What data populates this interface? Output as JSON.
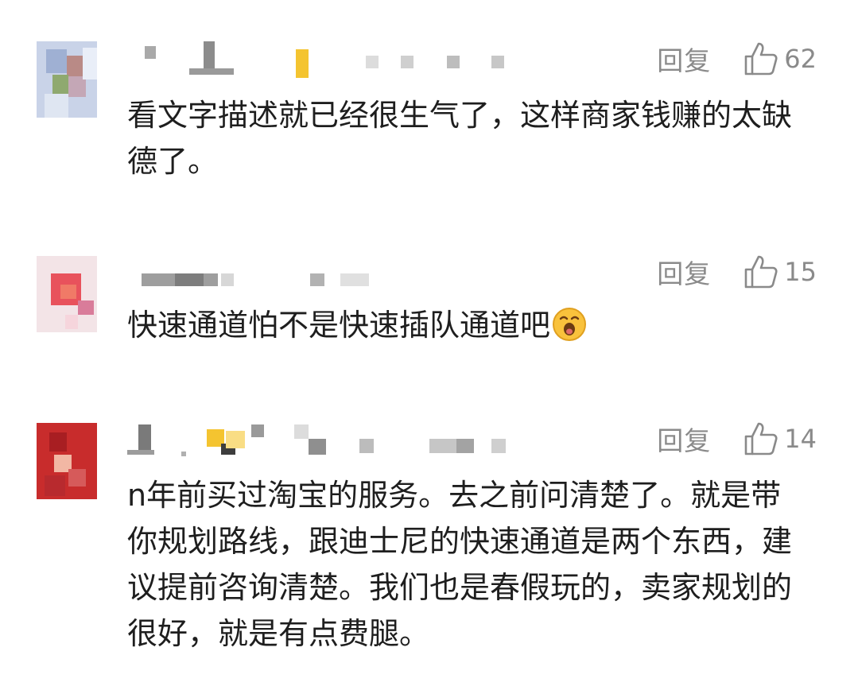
{
  "comments": [
    {
      "reply_label": "回复",
      "likes": "62",
      "text": "看文字描述就已经很生气了，这样商家钱赚的太缺德了。"
    },
    {
      "reply_label": "回复",
      "likes": "15",
      "text": "快速通道怕不是快速插队通道吧",
      "emoji": "face-emoji-icon"
    },
    {
      "reply_label": "回复",
      "likes": "14",
      "text": "n年前买过淘宝的服务。去之前问清楚了。就是带你规划路线，跟迪士尼的快速通道是两个东西，建议提前咨询清楚。我们也是春假玩的，卖家规划的很好，就是有点费腿。"
    }
  ],
  "colors": {
    "meta_gray": "#8a8a8a",
    "text": "#1e1e1e",
    "background": "#ffffff"
  }
}
